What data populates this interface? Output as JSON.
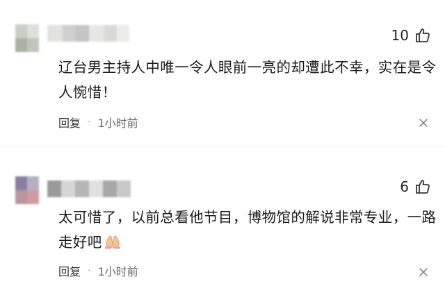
{
  "comments": [
    {
      "text": "辽台男主持人中唯一令人眼前一亮的却遭此不幸，实在是令人惋惜！",
      "likes": "10",
      "reply_label": "回复",
      "separator": "·",
      "time": "1小时前"
    },
    {
      "text": "太可惜了，以前总看他节目，博物馆的解说非常专业，一路走好吧",
      "emoji": "folded-hands-icon",
      "likes": "6",
      "reply_label": "回复",
      "separator": "·",
      "time": "1小时前"
    }
  ],
  "icons": {
    "like": "thumbs-up-icon",
    "dismiss": "close-icon"
  },
  "colors": {
    "text": "#1a1a1a",
    "meta": "#666666",
    "icon": "#333333",
    "avatar_blur_1": [
      "#c9cfc6",
      "#a9b2a7",
      "#dde0da",
      "#bfc6bb"
    ],
    "username_blur_1": [
      "#d9dad8",
      "#c4c5c4",
      "#e2e2e0",
      "#cfcfd1"
    ],
    "avatar_blur_2": [
      "#8b7fa1",
      "#5d6c8f",
      "#b995a0",
      "#d29a9d"
    ],
    "username_blur_2": [
      "#9a9a9c",
      "#d6d6d6",
      "#b5b5b5",
      "#e0e0df"
    ]
  }
}
